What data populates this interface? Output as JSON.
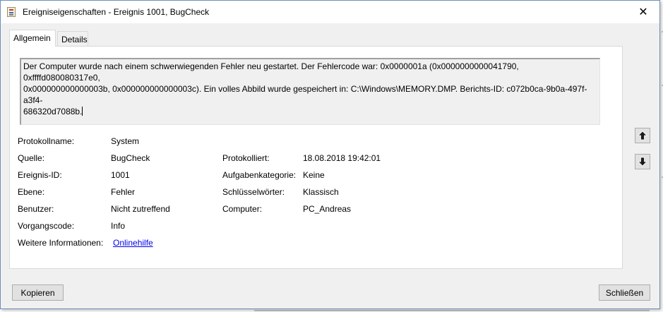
{
  "window": {
    "title": "Ereigniseigenschaften - Ereignis 1001, BugCheck",
    "icon": "event-viewer-icon",
    "close_glyph": "✕"
  },
  "tabs": [
    {
      "label": "Allgemein",
      "active": true
    },
    {
      "label": "Details",
      "active": false
    }
  ],
  "description": {
    "line1": "Der Computer wurde nach einem schwerwiegenden Fehler neu gestartet. Der Fehlercode war: 0x0000001a (0x0000000000041790, 0xffffd080080317e0,",
    "line2": "0x000000000000003b, 0x000000000000003c). Ein volles Abbild wurde gespeichert in: C:\\Windows\\MEMORY.DMP. Berichts-ID: c072b0ca-9b0a-497f-a3f4-",
    "line3": "686320d7088b."
  },
  "properties": {
    "protokollname": {
      "label": "Protokollname:",
      "value": "System"
    },
    "quelle": {
      "label": "Quelle:",
      "value": "BugCheck"
    },
    "protokolliert": {
      "label": "Protokolliert:",
      "value": "18.08.2018 19:42:01"
    },
    "ereignis_id": {
      "label": "Ereignis-ID:",
      "value": "1001"
    },
    "aufgabenkategorie": {
      "label": "Aufgabenkategorie:",
      "value": "Keine"
    },
    "ebene": {
      "label": "Ebene:",
      "value": "Fehler"
    },
    "schluesselwoerter": {
      "label": "Schlüsselwörter:",
      "value": "Klassisch"
    },
    "benutzer": {
      "label": "Benutzer:",
      "value": "Nicht zutreffend"
    },
    "computer": {
      "label": "Computer:",
      "value": "PC_Andreas"
    },
    "vorgangscode": {
      "label": "Vorgangscode:",
      "value": "Info"
    },
    "weitere_informationen": {
      "label": "Weitere Informationen:",
      "link": "Onlinehilfe"
    }
  },
  "buttons": {
    "copy": "Kopieren",
    "close": "Schließen"
  },
  "colors": {
    "link": "#0000ee",
    "window_border": "#6f8fb8",
    "dialog_bg": "#f0f0f0"
  }
}
